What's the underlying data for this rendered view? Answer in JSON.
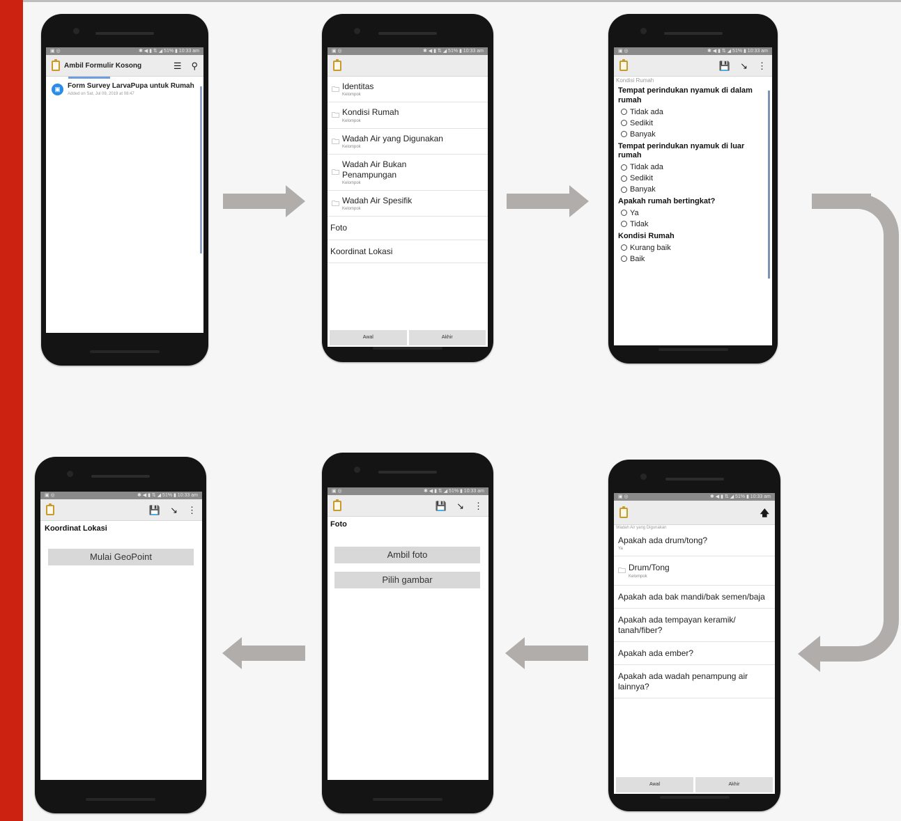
{
  "colors": {
    "accent_bar": "#cc2211",
    "arrow": "#b0adab",
    "phone_body": "#141414"
  },
  "statusbar": {
    "left": "▣ ◎",
    "right": "✱ ◀ ▮ ⇅ ◢ 51% ▮ 10:33 am"
  },
  "screen1": {
    "title": "Ambil Formulir Kosong",
    "form_title": "Form Survey LarvaPupa untuk Rumah",
    "form_added": "Added on Sat, Jul 09, 2019 at 08:47"
  },
  "screen2": {
    "groups": [
      {
        "title": "Identitas",
        "sub": "Kelompok"
      },
      {
        "title": "Kondisi Rumah",
        "sub": "Kelompok"
      },
      {
        "title": "Wadah Air yang Digunakan",
        "sub": "Kelompok"
      },
      {
        "title": "Wadah Air Bukan Penampungan",
        "sub": "Kelompok"
      },
      {
        "title": "Wadah Air Spesifik",
        "sub": "Kelompok"
      }
    ],
    "items": [
      "Foto",
      "Koordinat Lokasi"
    ],
    "nav": {
      "first": "Awal",
      "last": "Akhir"
    }
  },
  "screen3": {
    "section": "Kondisi Rumah",
    "q1": "Tempat perindukan nyamuk di dalam rumah",
    "q1_opts": [
      "Tidak ada",
      "Sedikit",
      "Banyak"
    ],
    "q2": "Tempat perindukan nyamuk di luar rumah",
    "q2_opts": [
      "Tidak ada",
      "Sedikit",
      "Banyak"
    ],
    "q3": "Apakah rumah bertingkat?",
    "q3_opts": [
      "Ya",
      "Tidak"
    ],
    "q4": "Kondisi Rumah",
    "q4_opts": [
      "Kurang baik",
      "Baik"
    ]
  },
  "screen4": {
    "section": "Wadah Air yang Digunakan",
    "q_drum": "Apakah ada drum/tong?",
    "q_drum_ans": "Ya",
    "group": "Drum/Tong",
    "group_sub": "Kelompok",
    "q_bak": "Apakah ada bak mandi/bak semen/baja",
    "q_tempayan": "Apakah ada tempayan keramik/ tanah/fiber?",
    "q_ember": "Apakah ada ember?",
    "q_lain": "Apakah ada wadah penampung air lainnya?",
    "nav": {
      "first": "Awal",
      "last": "Akhir"
    }
  },
  "screen5": {
    "label": "Foto",
    "btn_take": "Ambil foto",
    "btn_pick": "Pilih gambar"
  },
  "screen6": {
    "label": "Koordinat Lokasi",
    "btn_geo": "Mulai GeoPoint"
  }
}
